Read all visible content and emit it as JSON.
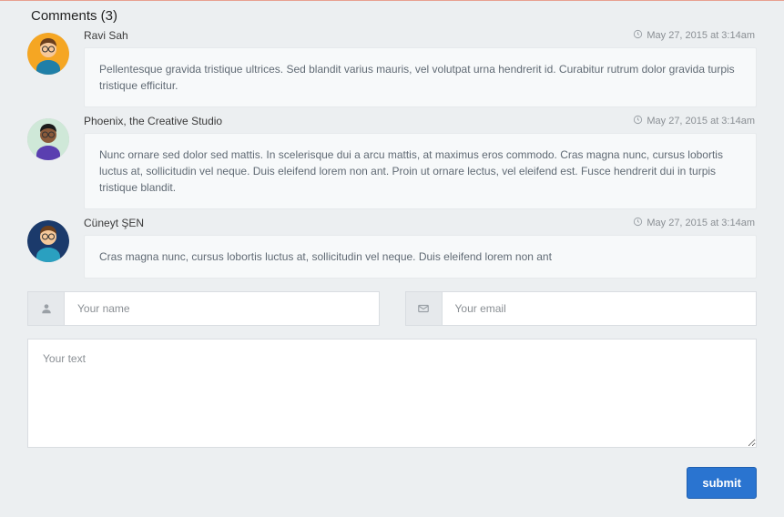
{
  "title": "Comments (3)",
  "comments": [
    {
      "author": "Ravi Sah",
      "date": "May 27, 2015 at 3:14am",
      "text": "Pellentesque gravida tristique ultrices. Sed blandit varius mauris, vel volutpat urna hendrerit id. Curabitur rutrum dolor gravida turpis tristique efficitur.",
      "avatar_colors": {
        "bg": "#f5a623",
        "hair": "#6b3f1d",
        "skin": "#f6c89a",
        "shirt": "#1f7fa8"
      }
    },
    {
      "author": "Phoenix, the Creative Studio",
      "date": "May 27, 2015 at 3:14am",
      "text": "Nunc ornare sed dolor sed mattis. In scelerisque dui a arcu mattis, at maximus eros commodo. Cras magna nunc, cursus lobortis luctus at, sollicitudin vel neque. Duis eleifend lorem non ant. Proin ut ornare lectus, vel eleifend est. Fusce hendrerit dui in turpis tristique blandit.",
      "avatar_colors": {
        "bg": "#cfe8d8",
        "hair": "#1b1b1b",
        "skin": "#8a5a3a",
        "shirt": "#5a3fb0"
      }
    },
    {
      "author": "Cüneyt ŞEN",
      "date": "May 27, 2015 at 3:14am",
      "text": "Cras magna nunc, cursus lobortis luctus at, sollicitudin vel neque. Duis eleifend lorem non ant",
      "avatar_colors": {
        "bg": "#1b3a6b",
        "hair": "#6b3f1d",
        "skin": "#f6c89a",
        "shirt": "#2aa0c0"
      }
    }
  ],
  "form": {
    "name_placeholder": "Your name",
    "email_placeholder": "Your email",
    "text_placeholder": "Your text",
    "submit_label": "submit"
  }
}
